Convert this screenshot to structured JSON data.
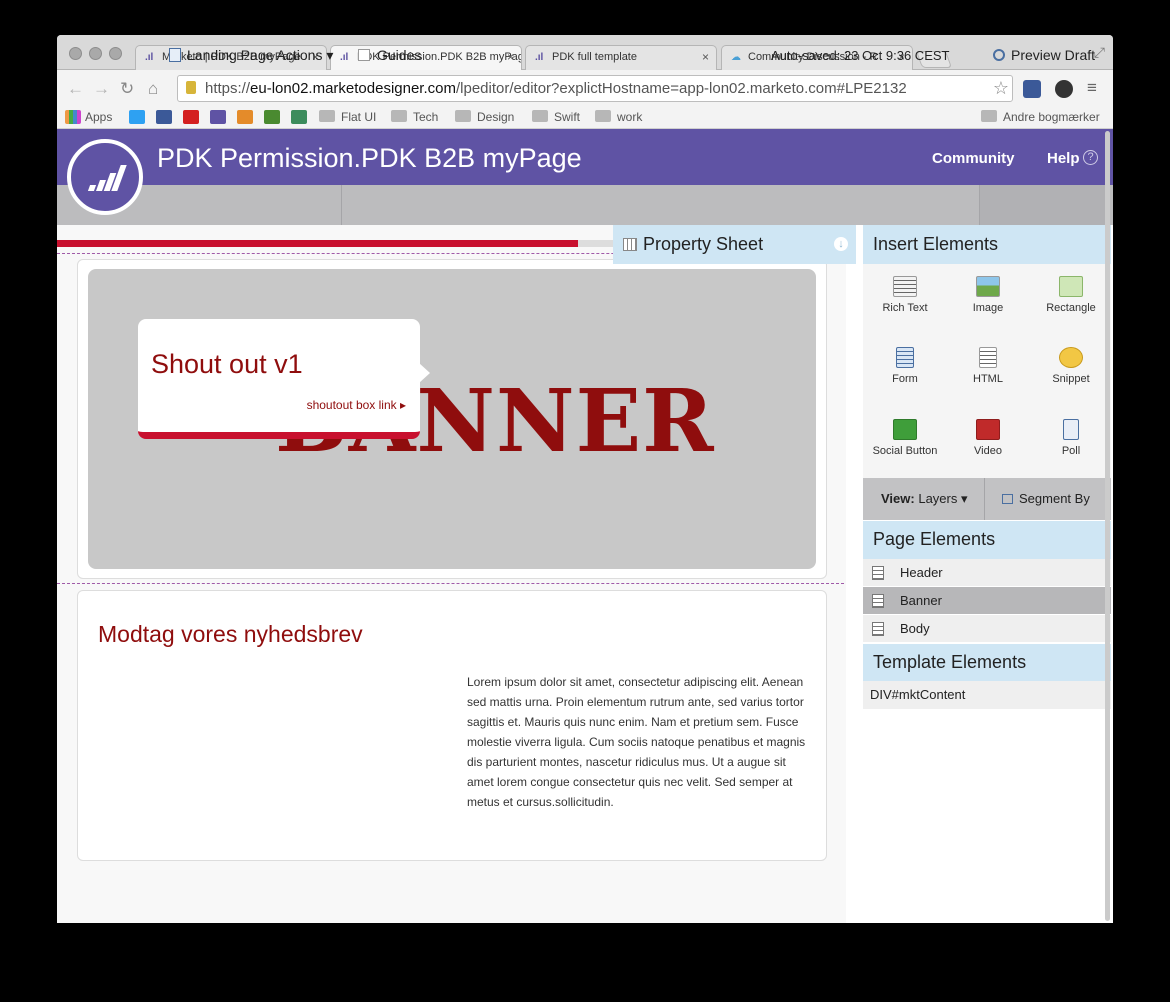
{
  "browser": {
    "tabs": [
      {
        "label": "Marketo | PDK B2B myPage",
        "active": false
      },
      {
        "label": "PDK Permission.PDK B2B myPage",
        "active": true
      },
      {
        "label": "PDK full template",
        "active": false
      },
      {
        "label": "Community Discussion - R",
        "active": false
      }
    ],
    "url_scheme": "https://",
    "url_host": "eu-lon02.marketodesigner.com",
    "url_path": "/lpeditor/editor?explictHostname=app-lon02.marketo.com#LPE2132",
    "bookmarks": {
      "apps": "Apps",
      "folders": [
        "Flat UI",
        "Tech",
        "Design",
        "Swift",
        "work"
      ],
      "other": "Andre bogmærker"
    }
  },
  "header": {
    "title": "PDK Permission.PDK B2B myPage",
    "community": "Community",
    "help": "Help",
    "help_icon": "?"
  },
  "actionbar": {
    "landing_page_actions": "Landing Page Actions ▾",
    "guides": "Guides",
    "autosaved": "Auto-saved: 23 Oct 9:36 CEST",
    "preview": "Preview Draft"
  },
  "canvas": {
    "banner_word": "BANNER",
    "shoutout_title": "Shout out v1",
    "shoutout_link": "shoutout box link ▸",
    "body_title": "Modtag vores nyhedsbrev",
    "body_text": "Lorem ipsum dolor sit amet, consectetur adipiscing elit. Aenean sed mattis urna. Proin elementum rutrum ante, sed varius tortor sagittis et. Mauris quis nunc enim. Nam et pretium sem. Fusce molestie viverra ligula. Cum sociis natoque penatibus et magnis dis parturient montes, nascetur ridiculus mus. Ut a augue sit amet lorem congue consectetur quis nec velit. Sed semper at metus et cursus.sollicitudin."
  },
  "panel": {
    "property_sheet": "Property Sheet",
    "insert_elements": "Insert Elements",
    "elements": [
      {
        "label": "Rich Text",
        "icon": "rich-text-icon",
        "color": "#f3f3f3"
      },
      {
        "label": "Image",
        "icon": "image-icon",
        "color": "#6ea84a"
      },
      {
        "label": "Rectangle",
        "icon": "rectangle-icon",
        "color": "#cfe7b7"
      },
      {
        "label": "Form",
        "icon": "form-icon",
        "color": "#d9e6f5"
      },
      {
        "label": "HTML",
        "icon": "html-icon",
        "color": "#f3f3f3"
      },
      {
        "label": "Snippet",
        "icon": "snippet-icon",
        "color": "#f2c744"
      },
      {
        "label": "Social Button",
        "icon": "share-icon",
        "color": "#3f9e3a"
      },
      {
        "label": "Video",
        "icon": "video-icon",
        "color": "#c02a2a"
      },
      {
        "label": "Poll",
        "icon": "poll-icon",
        "color": "#e9eef7"
      }
    ],
    "view_label": "View:",
    "view_value": "Layers ▾",
    "segment_by": "Segment By",
    "page_elements_title": "Page Elements",
    "page_elements": [
      {
        "label": "Header",
        "selected": false
      },
      {
        "label": "Banner",
        "selected": true
      },
      {
        "label": "Body",
        "selected": false
      }
    ],
    "template_elements_title": "Template Elements",
    "template_element": "DIV#mktContent"
  }
}
